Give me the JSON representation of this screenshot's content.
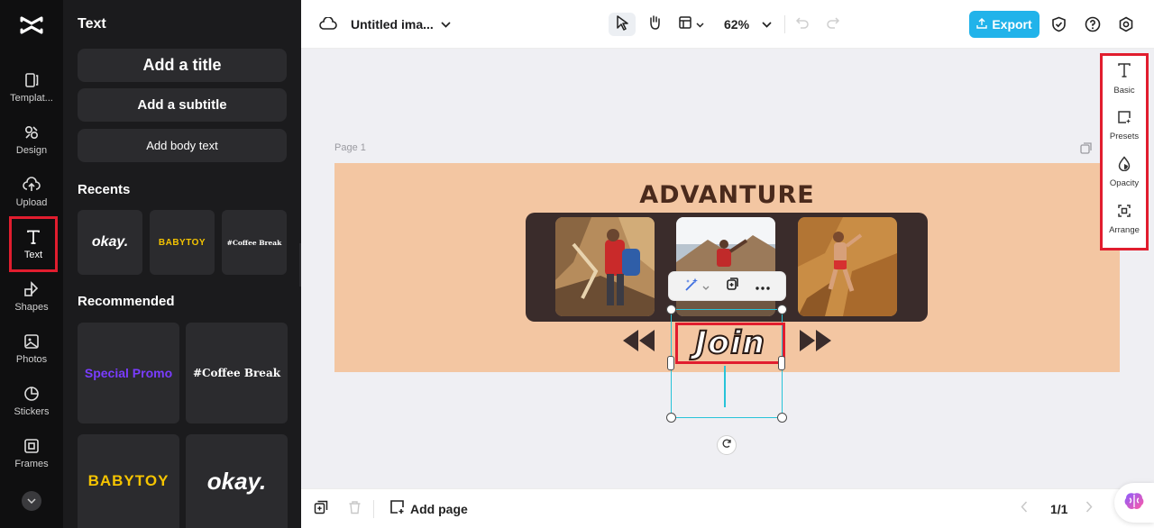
{
  "rail": {
    "items": [
      {
        "label": "Templat...",
        "icon": "template-icon"
      },
      {
        "label": "Design",
        "icon": "design-icon"
      },
      {
        "label": "Upload",
        "icon": "upload-icon"
      },
      {
        "label": "Text",
        "icon": "text-icon",
        "active": true
      },
      {
        "label": "Shapes",
        "icon": "shapes-icon"
      },
      {
        "label": "Photos",
        "icon": "photos-icon"
      },
      {
        "label": "Stickers",
        "icon": "stickers-icon"
      },
      {
        "label": "Frames",
        "icon": "frames-icon"
      }
    ]
  },
  "panel": {
    "title": "Text",
    "add_title": "Add a title",
    "add_subtitle": "Add a subtitle",
    "add_body": "Add body text",
    "recents_heading": "Recents",
    "recents": [
      "okay.",
      "BABYTOY",
      "#Coffee Break"
    ],
    "recommended_heading": "Recommended",
    "recommended": [
      "Special Promo",
      "#Coffee Break",
      "BABYTOY",
      "okay."
    ]
  },
  "topbar": {
    "doc_title": "Untitled ima...",
    "zoom": "62%",
    "export_label": "Export"
  },
  "canvas": {
    "page_label": "Page 1",
    "headline": "ADVANTURE",
    "selected_text": "Join"
  },
  "right_panel": {
    "items": [
      {
        "label": "Basic",
        "icon": "text-basic-icon"
      },
      {
        "label": "Presets",
        "icon": "presets-icon"
      },
      {
        "label": "Opacity",
        "icon": "opacity-icon"
      },
      {
        "label": "Arrange",
        "icon": "arrange-icon"
      }
    ]
  },
  "bottombar": {
    "add_page": "Add page",
    "page_counter": "1/1"
  },
  "colors": {
    "accent": "#21b3ea",
    "highlight": "#e11d2e",
    "design_bg": "#f3c6a2",
    "selection": "#27c3d8"
  }
}
